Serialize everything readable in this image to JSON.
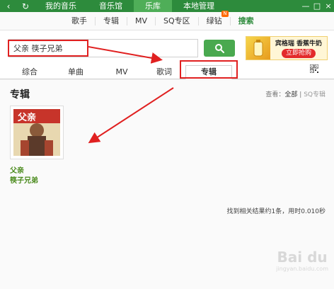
{
  "topbar": {
    "nav_back": "‹",
    "nav_refresh": "↻",
    "tabs": [
      {
        "label": "我的音乐"
      },
      {
        "label": "音乐馆"
      },
      {
        "label": "乐库"
      },
      {
        "label": "本地管理"
      }
    ],
    "active_tab": "乐库",
    "window_buttons": {
      "min": "—",
      "max": "□",
      "close": "×"
    }
  },
  "subnav": {
    "items": [
      {
        "label": "歌手"
      },
      {
        "label": "专辑"
      },
      {
        "label": "MV"
      },
      {
        "label": "SQ专区"
      },
      {
        "label": "绿钻",
        "badge": "N"
      },
      {
        "label": "搜索"
      }
    ],
    "active": "搜索"
  },
  "search": {
    "value": "父亲 筷子兄弟",
    "button_icon": "search-icon"
  },
  "ad": {
    "title": "宾格瑞 香蕉牛奶",
    "cta": "立即抢购"
  },
  "result_tabs": {
    "items": [
      {
        "label": "综合"
      },
      {
        "label": "单曲"
      },
      {
        "label": "MV"
      },
      {
        "label": "歌词"
      },
      {
        "label": "专辑"
      }
    ],
    "active": "专辑",
    "qr_icon": "qr-code-icon"
  },
  "main": {
    "section_title": "专辑",
    "view_label": "查看：",
    "view_all": "全部",
    "view_sep": "|",
    "view_sq": "SQ专辑",
    "album": {
      "name": "父亲",
      "artist": "筷子兄弟",
      "cover_text": "父亲"
    },
    "summary": "找到相关结果约1条，用时0.010秒"
  },
  "watermark": {
    "logo": "Bai du",
    "sub": "jingyan.baidu.com"
  },
  "colors": {
    "brand_green": "#2d8b3c",
    "accent_green": "#49a94f",
    "annotation_red": "#e02020",
    "link_green": "#4a8a1c"
  }
}
